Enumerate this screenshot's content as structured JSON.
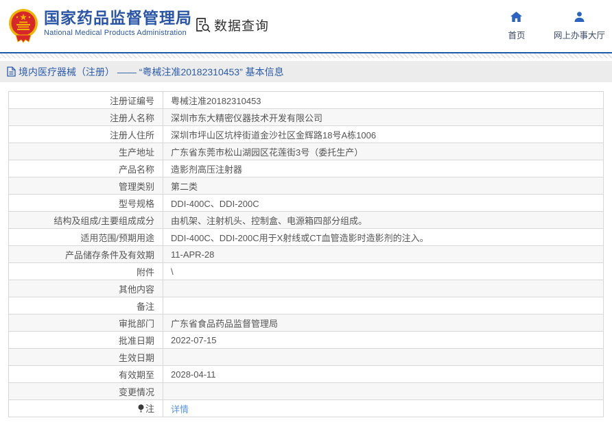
{
  "header": {
    "agency_name_zh": "国家药品监督管理局",
    "agency_name_en": "National Medical Products Administration",
    "data_query_label": "数据查询",
    "nav": [
      {
        "label": "首页",
        "icon": "home-icon"
      },
      {
        "label": "网上办事大厅",
        "icon": "user-icon"
      }
    ]
  },
  "breadcrumb": {
    "text": "境内医疗器械（注册） —— “粤械注准20182310453” 基本信息"
  },
  "table": {
    "rows": [
      {
        "label": "注册证编号",
        "value": "粤械注准20182310453"
      },
      {
        "label": "注册人名称",
        "value": "深圳市东大精密仪器技术开发有限公司"
      },
      {
        "label": "注册人住所",
        "value": "深圳市坪山区坑梓街道金沙社区金辉路18号A栋1006"
      },
      {
        "label": "生产地址",
        "value": "广东省东莞市松山湖园区花莲街3号（委托生产）"
      },
      {
        "label": "产品名称",
        "value": "造影剂高压注射器"
      },
      {
        "label": "管理类别",
        "value": "第二类"
      },
      {
        "label": "型号规格",
        "value": "DDI-400C、DDI-200C"
      },
      {
        "label": "结构及组成/主要组成成分",
        "value": "由机架、注射机头、控制盒、电源箱四部分组成。"
      },
      {
        "label": "适用范围/预期用途",
        "value": "DDI-400C、DDI-200C用于X射线或CT血管造影时造影剂的注入。"
      },
      {
        "label": "产品储存条件及有效期",
        "value": "11-APR-28"
      },
      {
        "label": "附件",
        "value": "\\"
      },
      {
        "label": "其他内容",
        "value": ""
      },
      {
        "label": "备注",
        "value": ""
      },
      {
        "label": "审批部门",
        "value": "广东省食品药品监督管理局"
      },
      {
        "label": "批准日期",
        "value": "2022-07-15"
      },
      {
        "label": "生效日期",
        "value": ""
      },
      {
        "label": "有效期至",
        "value": "2028-04-11"
      },
      {
        "label": "变更情况",
        "value": ""
      },
      {
        "label": "注",
        "value": "详情",
        "is_link": true,
        "has_icon": true,
        "icon": "note-balloon-icon"
      }
    ]
  },
  "colors": {
    "brand_blue": "#2b56a7",
    "nav_icon_blue": "#2a64c0",
    "divider_blue": "#1a5dab",
    "link_blue": "#5a96e0",
    "emblem_red": "#d6282a",
    "emblem_gold": "#f0b400",
    "bar_gray": "#ececec",
    "row_alt_gray": "#f7f7f7",
    "border_gray": "#d7d7d7"
  }
}
